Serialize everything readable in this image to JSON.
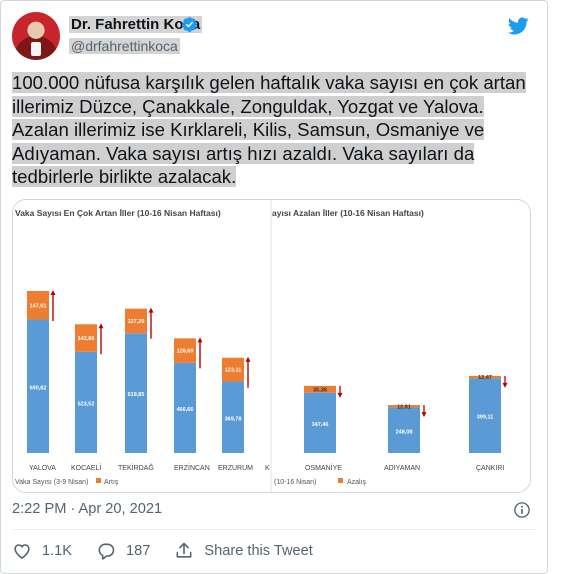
{
  "author": {
    "name": "Dr. Fahrettin Koca",
    "handle": "@drfahrettinkoca"
  },
  "tweet": {
    "lines": [
      "100.000 nüfusa karşılık gelen haftalık vaka sayısı en çok artan",
      "illerimiz Düzce, Çanakkale, Zonguldak, Yozgat ve Yalova.",
      "Azalan illerimiz ise Kırklareli, Kilis, Samsun, Osmaniye ve",
      "Adıyaman. Vaka sayısı artış hızı azaldı. Vaka sayıları da",
      "tedbirlerle birlikte azalacak."
    ],
    "timestamp": "2:22 PM · Apr 20, 2021"
  },
  "actions": {
    "likes": "1.1K",
    "replies": "187",
    "share_label": "Share this Tweet"
  },
  "colors": {
    "bar_blue": "#5b9bd5",
    "bar_orange": "#ed7d31",
    "arrow_red": "#c00000",
    "twitter_blue": "#1d9bf0"
  },
  "chart_data": [
    {
      "type": "bar",
      "stacked": true,
      "title": "Vaka Sayısı En Çok Artan İller (10-16 Nisan Haftası)",
      "categories": [
        "YALOVA",
        "KOCAELİ",
        "TEKİRDAĞ",
        "ERZİNCAN",
        "ERZURUM",
        "K"
      ],
      "series": [
        {
          "name": "Vaka Sayısı (3-9 Nisan)",
          "values": [
            690.82,
            523.52,
            619.85,
            466.66,
            369.78
          ]
        },
        {
          "name": "Artış",
          "values": [
            147.61,
            142.86,
            127.2,
            126.69,
            123.11
          ]
        }
      ],
      "value_labels": {
        "base": [
          "690,82",
          "523,52",
          "619,85",
          "466,66",
          "369,78"
        ],
        "increase": [
          "147,61",
          "142,86",
          "127,20",
          "126,69",
          "123,11"
        ]
      },
      "legend": [
        "Vaka Sayısı (3-9 Nisan)",
        "Artış"
      ],
      "trend": "up"
    },
    {
      "type": "bar",
      "stacked": true,
      "title": "ayısı Azalan İller (10-16 Nisan Haftası)",
      "categories": [
        "OSMANİYE",
        "ADIYAMAN",
        "ÇANKIRI"
      ],
      "series": [
        {
          "name": "(10-16 Nisan)",
          "values": [
            347.46,
            248.08,
            399.11
          ]
        },
        {
          "name": "Azalış",
          "values": [
            35.36,
            12.81,
            12.47
          ]
        }
      ],
      "value_labels": {
        "base": [
          "347,46",
          "248,08",
          "399,11"
        ],
        "decrease": [
          "35,36",
          "12,81",
          "12,47"
        ]
      },
      "legend": [
        "(10-16 Nisan)",
        "Azalış"
      ],
      "trend": "down"
    }
  ]
}
